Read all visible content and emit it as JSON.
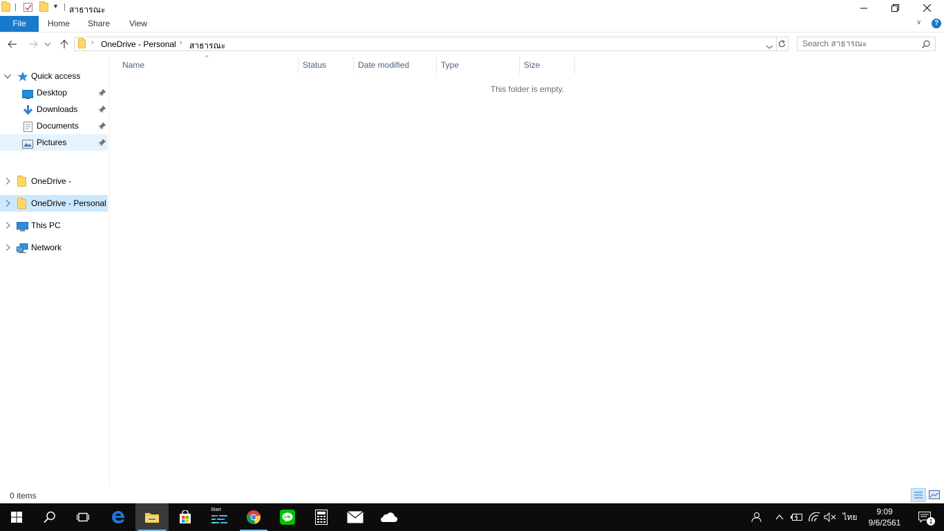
{
  "window": {
    "title": "สาธารณะ",
    "controls": {
      "minimize": "—",
      "restore": "❐",
      "close": "✕"
    }
  },
  "ribbon": {
    "tabs": [
      "File",
      "Home",
      "Share",
      "View"
    ],
    "help": "?"
  },
  "address": {
    "breadcrumbs": [
      "OneDrive - Personal",
      "สาธารณะ"
    ],
    "search_placeholder": "Search สาธารณะ"
  },
  "navpane": {
    "quick_access": {
      "label": "Quick access",
      "items": [
        {
          "label": "Desktop",
          "icon": "desktop-icon",
          "pinned": true
        },
        {
          "label": "Downloads",
          "icon": "downloads-icon",
          "pinned": true
        },
        {
          "label": "Documents",
          "icon": "documents-icon",
          "pinned": true
        },
        {
          "label": "Pictures",
          "icon": "pictures-icon",
          "pinned": true
        }
      ]
    },
    "roots": [
      {
        "label": "OneDrive -",
        "icon": "folder-icon"
      },
      {
        "label": "OneDrive - Personal",
        "icon": "folder-icon",
        "selected": true
      },
      {
        "label": "This PC",
        "icon": "pc-icon"
      },
      {
        "label": "Network",
        "icon": "network-icon"
      }
    ]
  },
  "content": {
    "columns": [
      "Name",
      "Status",
      "Date modified",
      "Type",
      "Size"
    ],
    "empty_message": "This folder is empty."
  },
  "statusbar": {
    "item_count": "0 items"
  },
  "taskbar": {
    "apps": [
      "start",
      "search",
      "task-view",
      "edge",
      "file-explorer",
      "store",
      "start-app",
      "chrome",
      "line",
      "calculator",
      "mail",
      "onedrive"
    ],
    "start_app_label": "Start",
    "tray": {
      "language": "ไทย",
      "time": "9:09",
      "date": "9/6/2561",
      "notification_count": "1"
    }
  },
  "colors": {
    "accent": "#1979ca",
    "selection": "#cce8ff",
    "taskbar": "#0c0c0c"
  }
}
